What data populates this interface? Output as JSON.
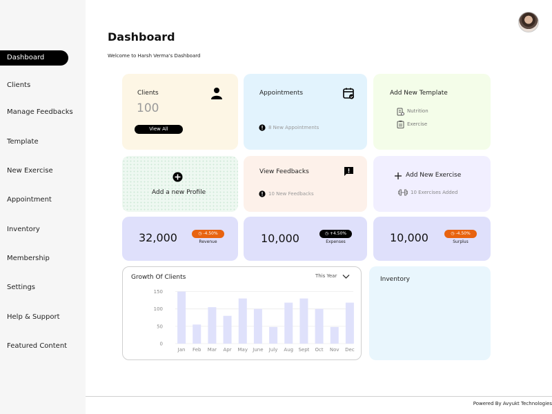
{
  "sidebar": {
    "items": [
      {
        "label": "Dashboard"
      },
      {
        "label": "Clients"
      },
      {
        "label": "Manage Feedbacks"
      },
      {
        "label": "Template"
      },
      {
        "label": "New Exercise"
      },
      {
        "label": "Appointment"
      },
      {
        "label": "Inventory"
      },
      {
        "label": "Membership"
      },
      {
        "label": "Settings"
      },
      {
        "label": "Help & Support"
      },
      {
        "label": "Featured Content"
      }
    ]
  },
  "header": {
    "title": "Dashboard",
    "welcome": "Welcome to Harsh Verma's Dashboard"
  },
  "cards": {
    "clients": {
      "title": "Clients",
      "count": "100",
      "button": "View All"
    },
    "appointments": {
      "title": "Appointments",
      "sub": "8 New Appointments"
    },
    "template": {
      "title": "Add New Template",
      "items": [
        "Nutrition",
        "Exercise"
      ]
    },
    "profile": {
      "title": "Add a new Profile"
    },
    "feedbacks": {
      "title": "View Feedbacks",
      "sub": "10 New Feedbacks"
    },
    "exercise": {
      "title": "Add New Exercise",
      "sub": "10 Exercises Added"
    }
  },
  "stats": [
    {
      "value": "32,000",
      "badge": "-4.50%",
      "label": "Revenue",
      "badge_color": "#e8630f"
    },
    {
      "value": "10,000",
      "badge": "+4.50%",
      "label": "Expenses",
      "badge_color": "#000000"
    },
    {
      "value": "10,000",
      "badge": "-4.50%",
      "label": "Surplus",
      "badge_color": "#e8630f"
    }
  ],
  "growth": {
    "title": "Growth Of Clients",
    "period": "This Year"
  },
  "inventory": {
    "title": "Inventory"
  },
  "chart_data": {
    "type": "bar",
    "categories": [
      "Jan",
      "Feb",
      "Mar",
      "Apr",
      "May",
      "June",
      "July",
      "Aug",
      "Sept",
      "Oct",
      "Nov",
      "Dec"
    ],
    "values": [
      150,
      55,
      105,
      80,
      130,
      100,
      48,
      118,
      130,
      100,
      48,
      118
    ],
    "yticks": [
      "0",
      "50",
      "100",
      "150"
    ],
    "ylim": [
      0,
      155
    ],
    "bar_color": "#dfe1fb"
  },
  "footer": {
    "text": "Powered By Avyukt Technologies"
  },
  "colors": {
    "clients_bg": "#fdf6e5",
    "appointments_bg": "#e2f3fd",
    "template_bg": "#f4fde9",
    "feedbacks_bg": "#fdf1ea",
    "exercise_bg": "#f1efff",
    "stat_bg": "#dfe0fb",
    "inventory_bg": "#e9f6fd"
  }
}
